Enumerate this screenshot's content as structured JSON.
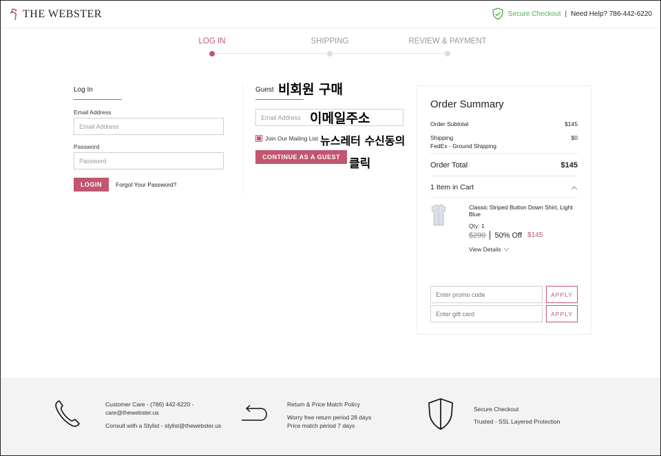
{
  "header": {
    "brand": "THE WEBSTER",
    "secure_checkout": "Secure Checkout",
    "separator": "|",
    "help": "Need Help? 786-442-6220"
  },
  "steps": [
    "LOG IN",
    "SHIPPING",
    "REVIEW & PAYMENT"
  ],
  "active_step": "LOG IN",
  "login": {
    "title": "Log In",
    "email_label": "Email Address",
    "email_placeholder": "Email Address",
    "password_label": "Password",
    "password_placeholder": "Password",
    "login_button": "LOGIN",
    "forgot": "Forgot Your Password?"
  },
  "guest": {
    "title": "Guest",
    "email_placeholder": "Email Address",
    "mailing_list": "Join Our Mailing List",
    "continue_button": "CONTINUE AS A GUEST"
  },
  "annotations": {
    "guest_purchase": "비회원 구매",
    "email": "이메일주소",
    "newsletter": "뉴스레터 수신동의",
    "click": "클릭"
  },
  "summary": {
    "title": "Order Summary",
    "subtotal_label": "Order Subtotal",
    "subtotal_value": "$145",
    "shipping_label": "Shipping",
    "shipping_value": "$0",
    "shipping_method": "FedEx - Ground Shipping",
    "total_label": "Order Total",
    "total_value": "$145",
    "cart_count": "1 Item in Cart",
    "item": {
      "name": "Classic Striped Button Down Shirt, Light Blue",
      "qty": "Qty: 1",
      "old_price": "$290",
      "discount": "50% Off",
      "price": "$145",
      "view_details": "View Details"
    },
    "promo_placeholder": "Enter promo code",
    "gift_placeholder": "Enter gift card",
    "apply": "APPLY"
  },
  "footer": {
    "care_line1": "Customer Care - (786) 442-6220 -",
    "care_line2": "care@thewebster.us",
    "stylist": "Consult with a Stylist - stylist@thewebster.us",
    "return_title": "Return & Price Match Policy",
    "return_line1": "Worry free return period 28 days",
    "return_line2": "Price match period 7 days",
    "secure_title": "Secure Checkout",
    "secure_line": "Trusted - SSL Layered Protection"
  },
  "colors": {
    "accent": "#c0566f",
    "secure_green": "#4caf50",
    "footer_bg": "#f3f3f3"
  }
}
